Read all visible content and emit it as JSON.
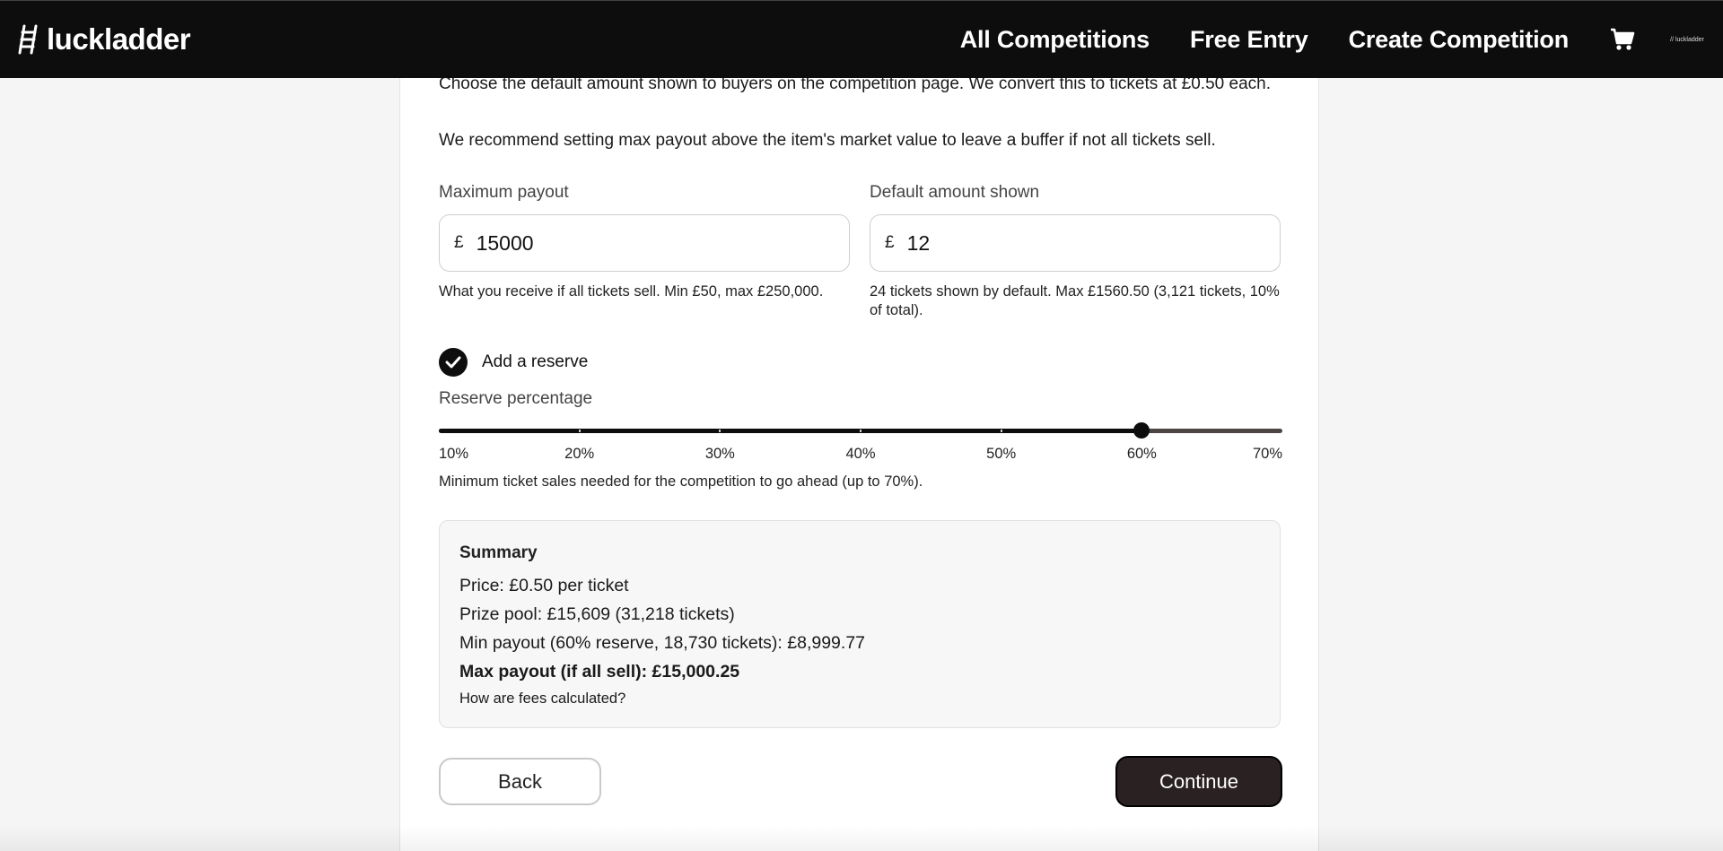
{
  "nav": {
    "brand": "luckladder",
    "links": [
      "All Competitions",
      "Free Entry",
      "Create Competition"
    ],
    "mini_logo": "// luckladder"
  },
  "intro": {
    "line1": "Choose the default amount shown to buyers on the competition page. We convert this to tickets at £0.50 each.",
    "line2": "We recommend setting max payout above the item's market value to leave a buffer if not all tickets sell."
  },
  "max_payout": {
    "label": "Maximum payout",
    "currency": "£",
    "value": "15000",
    "help": "What you receive if all tickets sell. Min £50, max £250,000."
  },
  "default_amount": {
    "label": "Default amount shown",
    "currency": "£",
    "value": "12",
    "help": "24 tickets shown by default. Max £1560.50 (3,121 tickets, 10% of total)."
  },
  "reserve": {
    "checkbox_label": "Add a reserve",
    "checked": true,
    "label": "Reserve percentage",
    "min": 10,
    "max": 70,
    "value": 60,
    "ticks": [
      "10%",
      "20%",
      "30%",
      "40%",
      "50%",
      "60%",
      "70%"
    ],
    "help": "Minimum ticket sales needed for the competition to go ahead (up to 70%)."
  },
  "summary": {
    "title": "Summary",
    "price": "Price: £0.50 per ticket",
    "prize_pool": "Prize pool: £15,609 (31,218 tickets)",
    "min_payout": "Min payout (60% reserve, 18,730 tickets): £8,999.77",
    "max_payout": "Max payout (if all sell): £15,000.25",
    "fees_link": "How are fees calculated?"
  },
  "buttons": {
    "back": "Back",
    "continue": "Continue"
  },
  "colors": {
    "navbar": "#0d0d0d",
    "accent": "#0d0d0d",
    "continue_bg": "#2a2222"
  }
}
